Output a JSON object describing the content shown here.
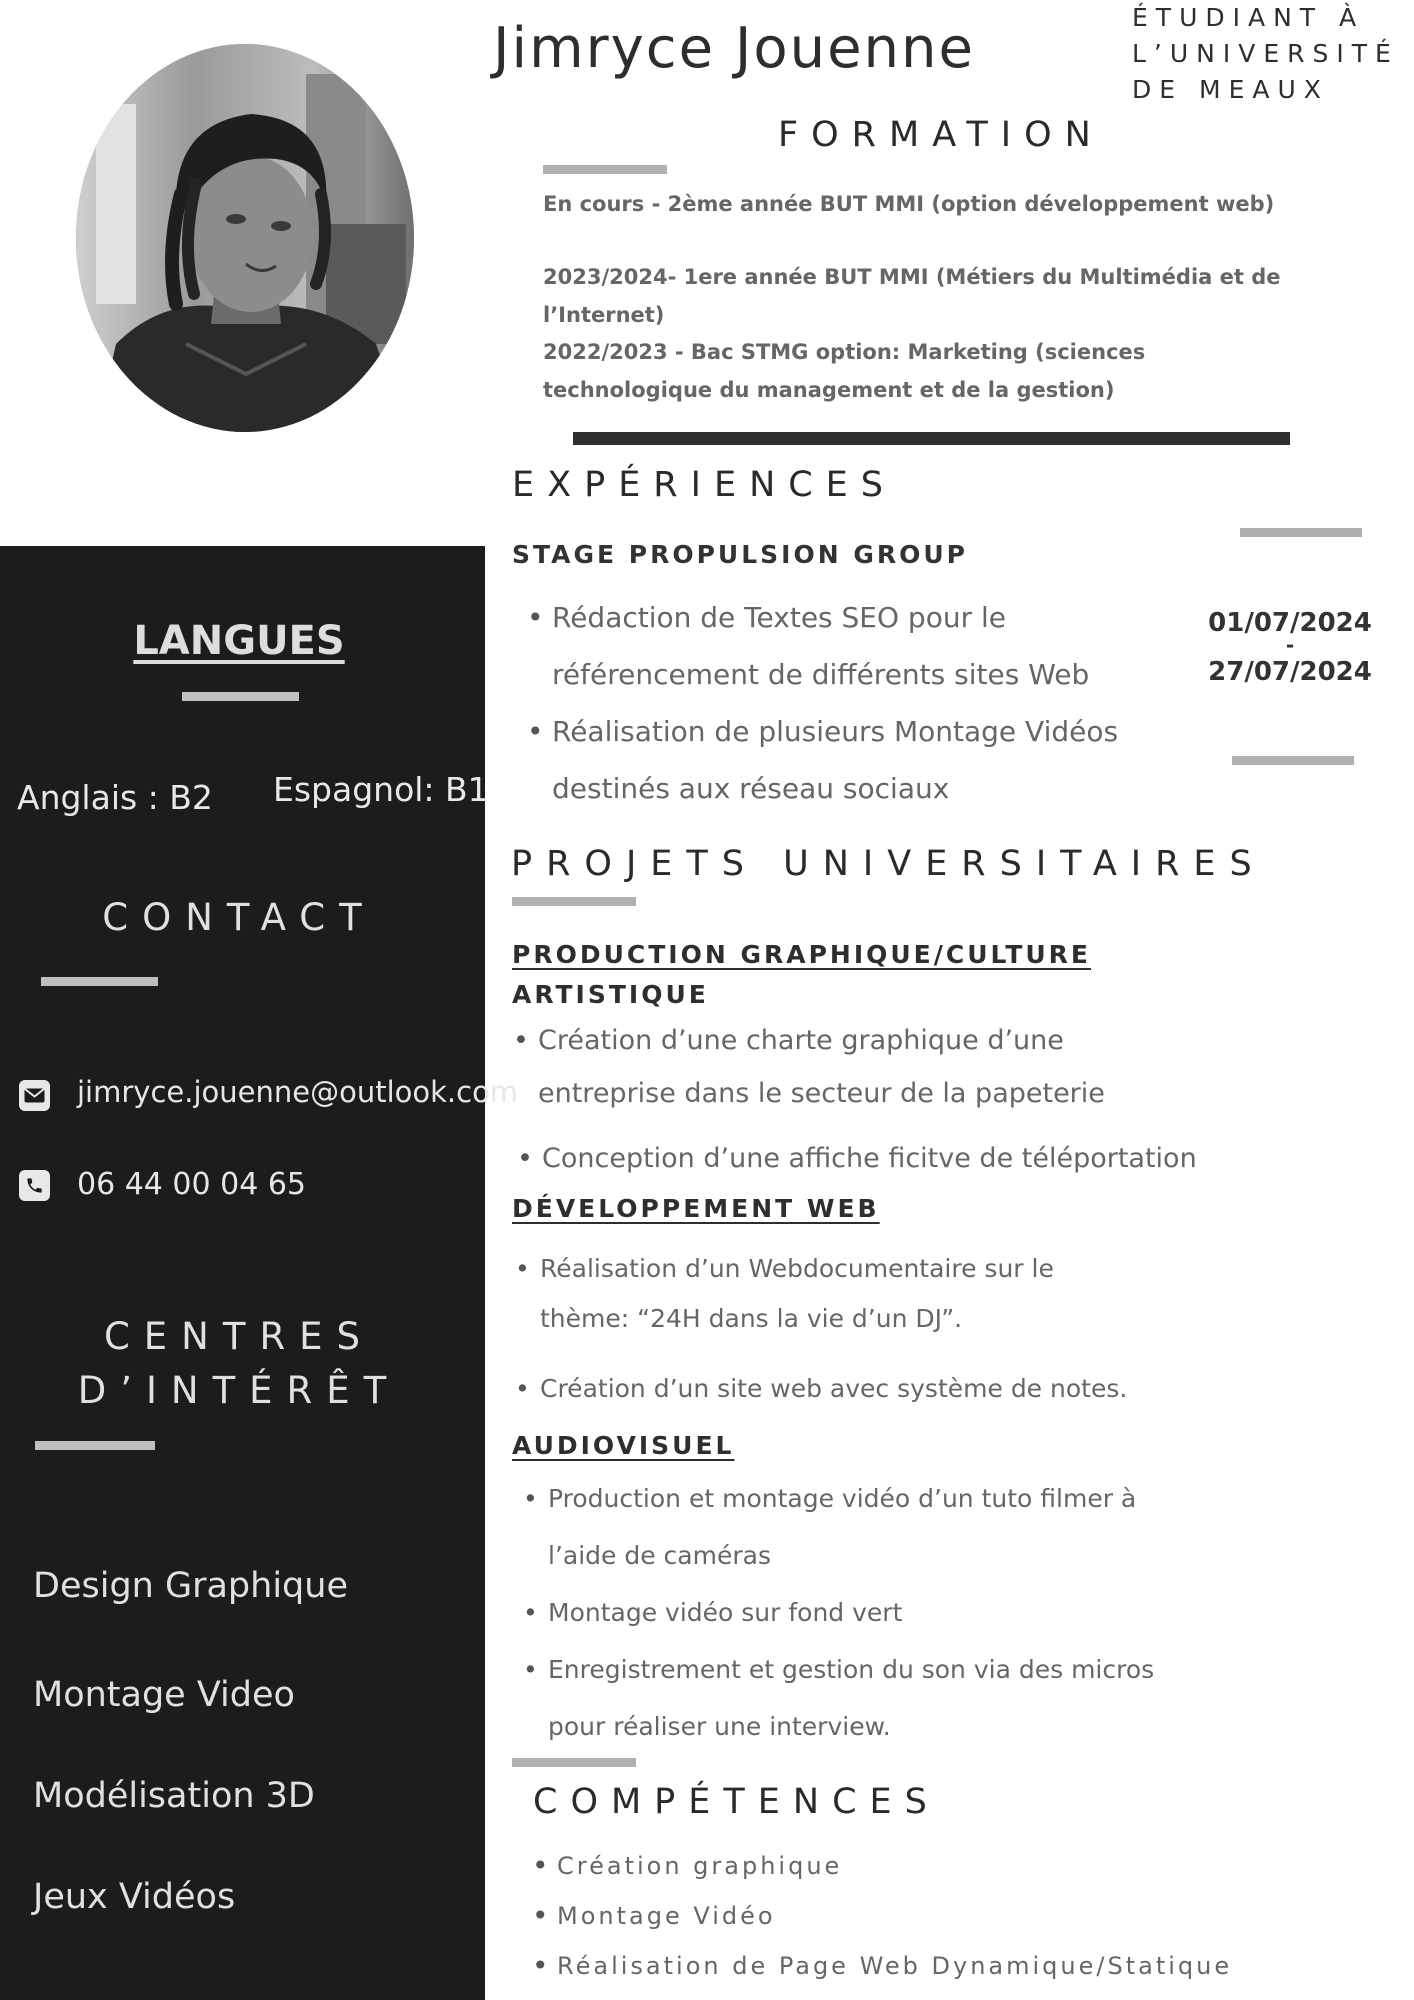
{
  "header": {
    "name": "Jimryce Jouenne",
    "subtitle_lines": [
      "ÉTUDIANT À",
      "L’UNIVERSITÉ",
      "DE MEAUX"
    ]
  },
  "formation": {
    "title": "FORMATION",
    "items": [
      "En cours - 2ème année BUT MMI (option développement web)",
      "2023/2024- 1ere année BUT MMI (Métiers du Multimédia et de l’Internet)",
      "2022/2023 - Bac STMG  option: Marketing (sciences technologique du management et de la gestion)"
    ]
  },
  "experiences": {
    "title": "EXPÉRIENCES",
    "job_title": "STAGE PROPULSION GROUP",
    "bullets": [
      "Rédaction de Textes SEO pour le",
      "référencement de différents sites Web",
      "Réalisation de plusieurs Montage Vidéos",
      "destinés aux réseau sociaux"
    ],
    "date_start": "01/07/2024",
    "date_sep": "-",
    "date_end": "27/07/2024"
  },
  "projets": {
    "title": "PROJETS UNIVERSITAIRES",
    "production": {
      "title_line1": "PRODUCTION GRAPHIQUE/CULTURE",
      "title_line2": "ARTISTIQUE",
      "bullets": [
        "Création d’une charte graphique d’une",
        "entreprise dans le secteur de la papeterie",
        "Conception d’une affiche ficitve de téléportation"
      ]
    },
    "dev_web": {
      "title": "DÉVELOPPEMENT WEB",
      "bullets": [
        "Réalisation d’un Webdocumentaire sur le",
        "thème: “24H dans la vie d’un DJ”.",
        "Création d’un site web avec système de notes."
      ]
    },
    "audiovisuel": {
      "title": "AUDIOVISUEL",
      "bullets": [
        "Production et montage vidéo d’un tuto filmer à",
        "l’aide de caméras",
        "Montage vidéo sur fond vert",
        "Enregistrement et gestion du son via des micros",
        "pour réaliser une interview."
      ]
    }
  },
  "competences": {
    "title": "COMPÉTENCES",
    "items": [
      "Création graphique",
      "Montage Vidéo",
      "Réalisation de Page Web Dynamique/Statique"
    ]
  },
  "sidebar": {
    "langues_title": "LANGUES",
    "lang_english": "Anglais :  B2",
    "lang_spanish": "Espagnol: B1",
    "contact_title": "CONTACT",
    "email": "jimryce.jouenne@outlook.com",
    "phone": "06 44 00 04 65",
    "interests_title_line1": "CENTRES",
    "interests_title_line2": "D’INTÉRÊT",
    "interests": [
      "Design Graphique",
      "Montage Video",
      "Modélisation 3D",
      "Jeux Vidéos"
    ],
    "icons": {
      "email": "envelope-icon",
      "phone": "phone-icon"
    }
  },
  "colors": {
    "sidebar_bg": "#1c1c1c",
    "accent_bar": "#b0b0b0",
    "dark_bar": "#2f2f2f"
  }
}
